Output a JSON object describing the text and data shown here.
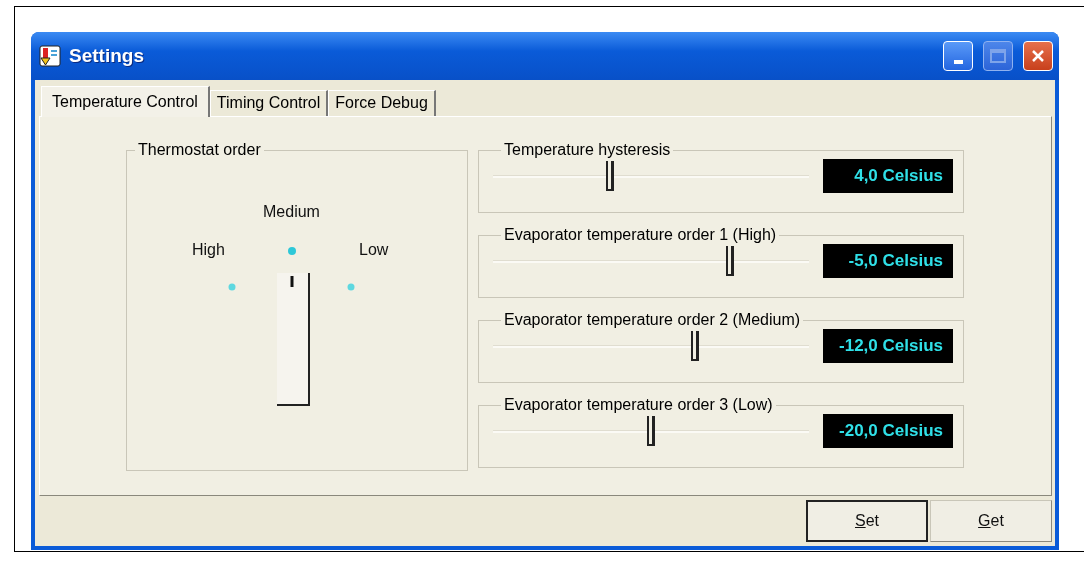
{
  "window": {
    "title": "Settings"
  },
  "tabs": [
    {
      "label": "Temperature Control",
      "selected": true
    },
    {
      "label": "Timing Control",
      "selected": false
    },
    {
      "label": "Force Debug",
      "selected": false
    }
  ],
  "thermostat": {
    "title": "Thermostat order",
    "options": [
      {
        "label": "High",
        "selected": false
      },
      {
        "label": "Medium",
        "selected": true
      },
      {
        "label": "Low",
        "selected": false
      }
    ]
  },
  "settings": [
    {
      "label": "Temperature hysteresis",
      "level": 0.37,
      "reading": "4,0 Celsius"
    },
    {
      "label": "Evaporator temperature order 1 (High)",
      "level": 0.75,
      "reading": "-5,0 Celsius"
    },
    {
      "label": "Evaporator temperature order 2 (Medium)",
      "level": 0.64,
      "reading": "-12,0 Celsius"
    },
    {
      "label": "Evaporator temperature order 3 (Low)",
      "level": 0.5,
      "reading": "-20,0 Celsius"
    }
  ],
  "buttons": [
    {
      "label": "Set",
      "default": true
    },
    {
      "label": "Get",
      "default": false
    }
  ]
}
